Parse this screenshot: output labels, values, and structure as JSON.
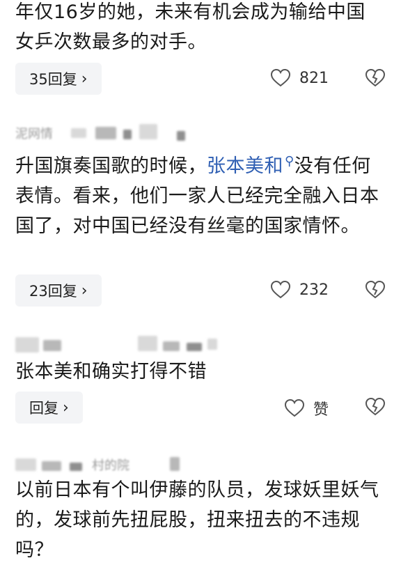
{
  "comments": [
    {
      "text_plain": "年仅16岁的她，未来有机会成为输给中国女乒次数最多的对手。",
      "reply_label": "35回复",
      "like_label": "821",
      "username": ""
    },
    {
      "username": "泥网情",
      "text_before": "升国旗奏国歌的时候，",
      "mention": "张本美和",
      "text_after": "没有任何表情。看来，他们一家人已经完全融入日本国了，对中国已经没有丝毫的国家情怀。",
      "reply_label": "23回复",
      "like_label": "232"
    },
    {
      "username": "",
      "text_plain": "张本美和确实打得不错",
      "reply_label": "回复",
      "like_label": "赞"
    },
    {
      "username": "村的院",
      "text_plain": "以前日本有个叫伊藤的队员，发球妖里妖气的，发球前先扭屁股，扭来扭去的不违规吗？"
    }
  ],
  "icons": {
    "reply_chevron": "chevron-right-icon",
    "like": "heart-outline-icon",
    "dislike": "broken-heart-icon",
    "search_mark": "search-icon"
  },
  "colors": {
    "mention": "#2f5fb3",
    "reply_bg": "#f3f4f6",
    "text": "#1a1a1a"
  }
}
